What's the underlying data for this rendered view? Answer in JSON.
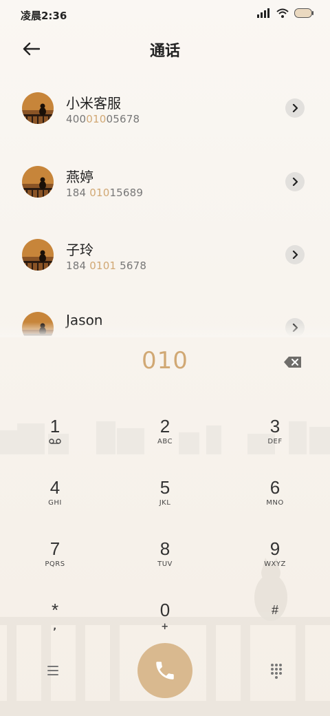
{
  "status_bar": {
    "time": "凌晨2:36",
    "icons": [
      "signal-icon",
      "wifi-icon",
      "battery-icon"
    ]
  },
  "header": {
    "title": "通话",
    "back_icon": "back-arrow-icon"
  },
  "contacts": [
    {
      "name": "小米客服",
      "number_parts": [
        "400",
        "010",
        "05678"
      ]
    },
    {
      "name": "燕婷",
      "number_parts": [
        "184 ",
        "010",
        "15689"
      ]
    },
    {
      "name": "子玲",
      "number_parts": [
        "184 ",
        "0101",
        " 5678"
      ]
    },
    {
      "name": "Jason",
      "number_parts": [
        "",
        "",
        ""
      ]
    }
  ],
  "dialer": {
    "dialed_number": "010",
    "backspace_icon": "backspace-icon"
  },
  "keypad": [
    {
      "digit": "1",
      "sub": ""
    },
    {
      "digit": "2",
      "sub": "ABC"
    },
    {
      "digit": "3",
      "sub": "DEF"
    },
    {
      "digit": "4",
      "sub": "GHI"
    },
    {
      "digit": "5",
      "sub": "JKL"
    },
    {
      "digit": "6",
      "sub": "MNO"
    },
    {
      "digit": "7",
      "sub": "PQRS"
    },
    {
      "digit": "8",
      "sub": "TUV"
    },
    {
      "digit": "9",
      "sub": "WXYZ"
    },
    {
      "digit": "*",
      "sub": ","
    },
    {
      "digit": "0",
      "sub": "+"
    },
    {
      "digit": "#",
      "sub": ""
    }
  ],
  "bottom_bar": {
    "menu_icon": "menu-icon",
    "call_icon": "phone-icon",
    "dialpad_icon": "dialpad-icon"
  },
  "colors": {
    "accent": "#d1a874",
    "call_button": "#d9b98f",
    "background": "#f9f6f2"
  }
}
